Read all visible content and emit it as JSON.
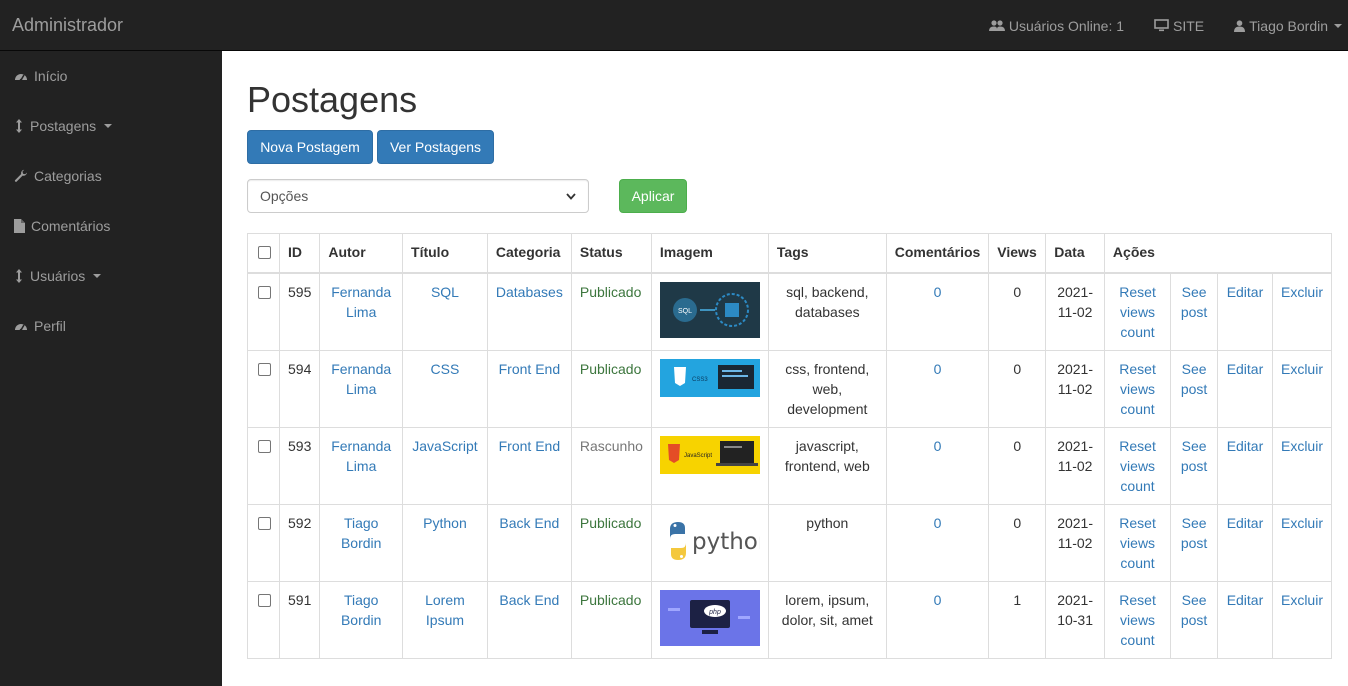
{
  "brand": "Administrador",
  "topnav": {
    "online": "Usuários Online: 1",
    "site": "SITE",
    "user": "Tiago Bordin"
  },
  "sidebar": {
    "items": [
      {
        "label": "Início",
        "icon": "dashboard-icon"
      },
      {
        "label": "Postagens",
        "icon": "arrows-vertical-icon",
        "dropdown": true
      },
      {
        "label": "Categorias",
        "icon": "wrench-icon"
      },
      {
        "label": "Comentários",
        "icon": "file-icon"
      },
      {
        "label": "Usuários",
        "icon": "arrows-vertical-icon",
        "dropdown": true
      },
      {
        "label": "Perfil",
        "icon": "dashboard-icon"
      }
    ]
  },
  "page": {
    "title": "Postagens",
    "new_post": "Nova Postagem",
    "view_posts": "Ver Postagens",
    "options_select": "Opções",
    "apply": "Aplicar"
  },
  "colors": {
    "navbar": "#222222",
    "primary": "#337ab7",
    "success": "#5cb85c",
    "link": "#337ab7",
    "published": "#3c763d"
  },
  "table": {
    "headers": [
      "ID",
      "Autor",
      "Título",
      "Categoria",
      "Status",
      "Imagem",
      "Tags",
      "Comentários",
      "Views",
      "Data",
      "Ações"
    ],
    "actions": [
      "Reset views count",
      "See post",
      "Editar",
      "Excluir"
    ],
    "rows": [
      {
        "id": "595",
        "author": "Fernanda Lima",
        "title": "SQL",
        "category": "Databases",
        "status": "Publicado",
        "image": "sql",
        "image_text": "SQL",
        "tags": "sql, backend, databases",
        "comments": "0",
        "views": "0",
        "date": "2021-11-02"
      },
      {
        "id": "594",
        "author": "Fernanda Lima",
        "title": "CSS",
        "category": "Front End",
        "status": "Publicado",
        "image": "css",
        "image_text": "CSS3",
        "tags": "css, frontend, web, development",
        "comments": "0",
        "views": "0",
        "date": "2021-11-02"
      },
      {
        "id": "593",
        "author": "Fernanda Lima",
        "title": "JavaScript",
        "category": "Front End",
        "status": "Rascunho",
        "image": "js",
        "image_text": "JavaScript",
        "tags": "javascript, frontend, web",
        "comments": "0",
        "views": "0",
        "date": "2021-11-02"
      },
      {
        "id": "592",
        "author": "Tiago Bordin",
        "title": "Python",
        "category": "Back End",
        "status": "Publicado",
        "image": "python",
        "image_text": "python",
        "tags": "python",
        "comments": "0",
        "views": "0",
        "date": "2021-11-02"
      },
      {
        "id": "591",
        "author": "Tiago Bordin",
        "title": "Lorem Ipsum",
        "category": "Back End",
        "status": "Publicado",
        "image": "php",
        "image_text": "php",
        "tags": "lorem, ipsum, dolor, sit, amet",
        "comments": "0",
        "views": "1",
        "date": "2021-10-31"
      }
    ]
  }
}
